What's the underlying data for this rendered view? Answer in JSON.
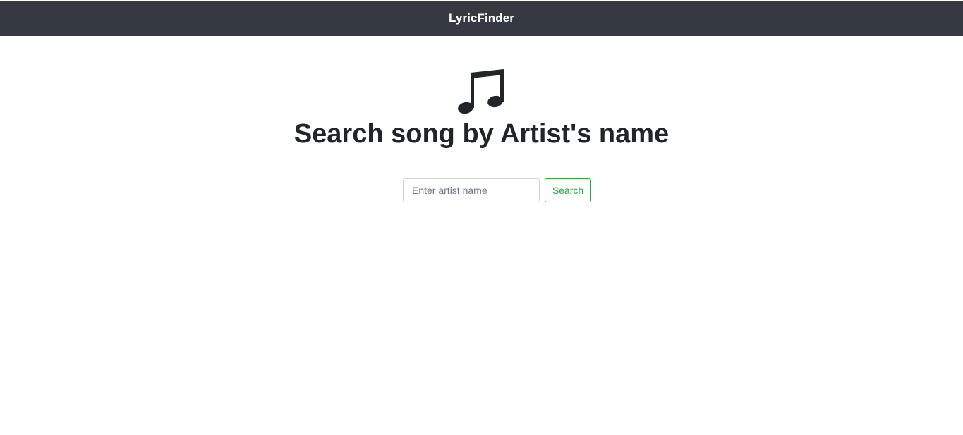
{
  "navbar": {
    "brand": "LyricFinder",
    "background_color": "#343a40"
  },
  "hero": {
    "icon": "music-note-icon",
    "title": "Search song by Artist's name"
  },
  "search": {
    "placeholder": "Enter artist name",
    "value": "",
    "button_label": "Search",
    "button_color": "#28a745"
  }
}
